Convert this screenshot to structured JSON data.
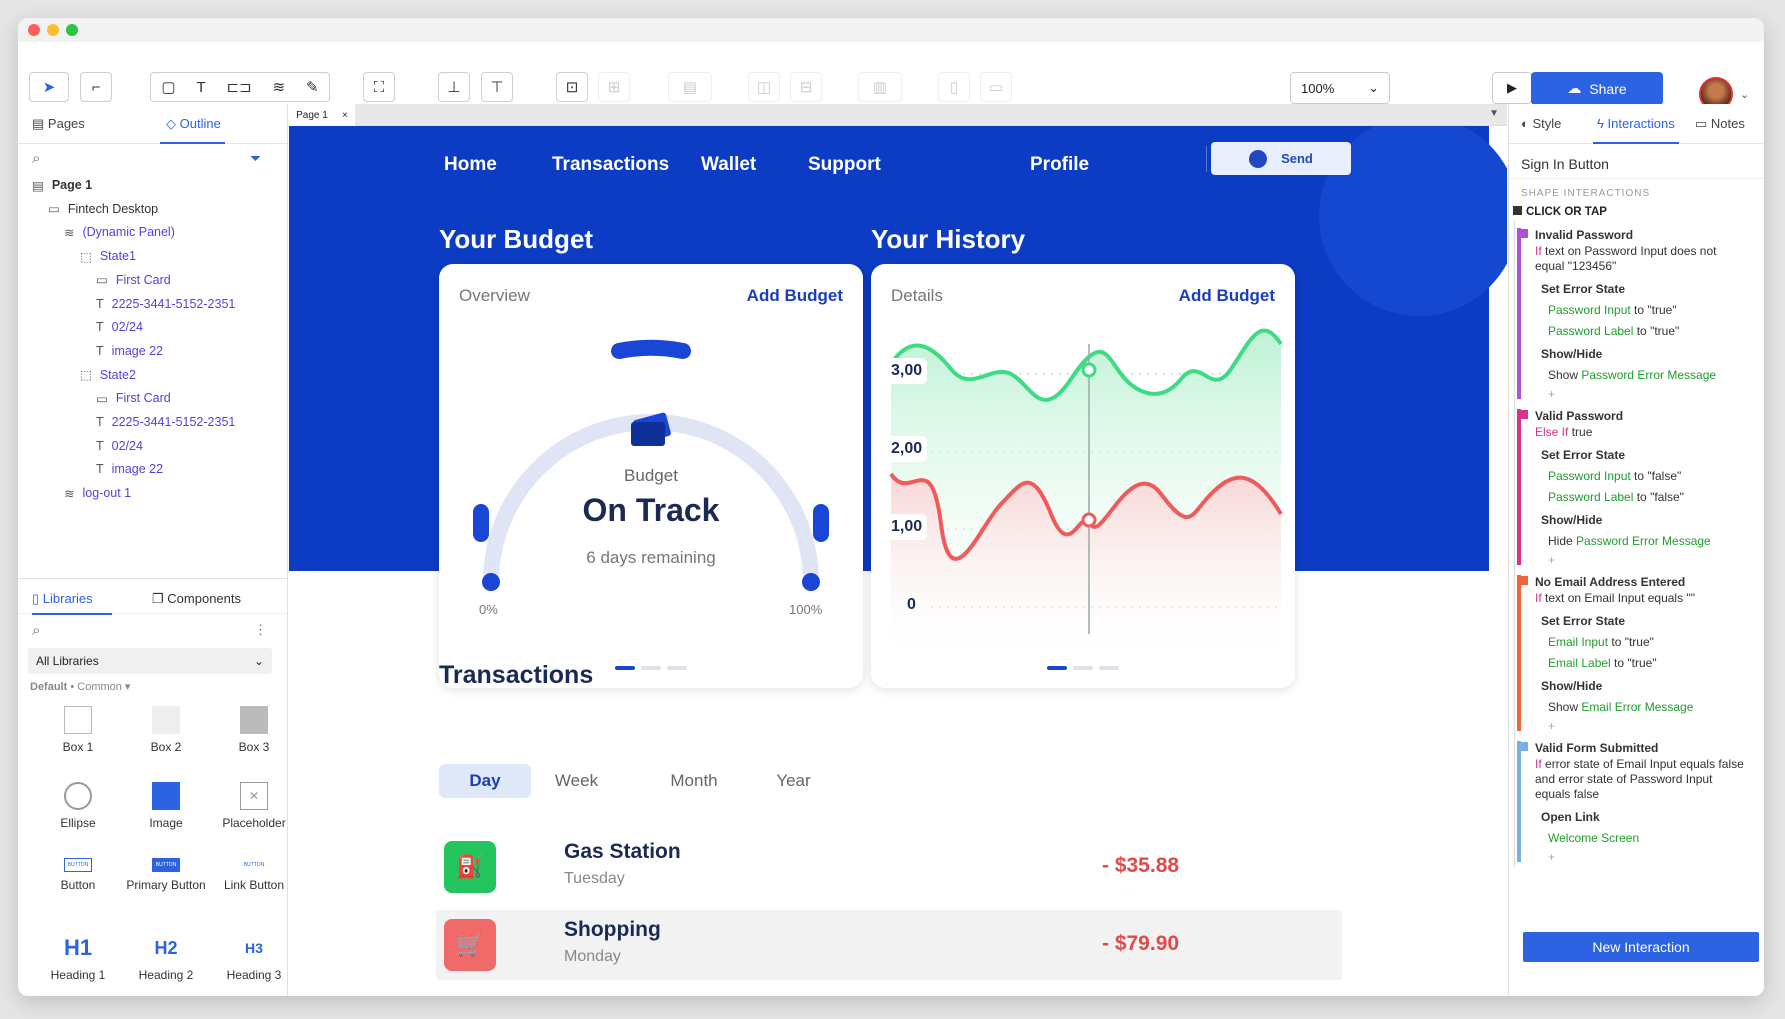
{
  "toolbar": {
    "zoom": "100%",
    "share": "Share"
  },
  "left_panel": {
    "tabs": {
      "pages": "Pages",
      "outline": "Outline"
    },
    "tree": [
      {
        "label": "Page 1",
        "indent": 0,
        "icon": "page-icon",
        "purple": false,
        "bold": true
      },
      {
        "label": "Fintech Desktop",
        "indent": 1,
        "icon": "folder-icon",
        "purple": false
      },
      {
        "label": "(Dynamic Panel)",
        "indent": 2,
        "icon": "layers-icon",
        "purple": true
      },
      {
        "label": "State1",
        "indent": 3,
        "icon": "state-icon",
        "purple": true
      },
      {
        "label": "First Card",
        "indent": 4,
        "icon": "rect-icon",
        "purple": true
      },
      {
        "label": "2225-3441-5152-2351",
        "indent": 4,
        "icon": "text-icon",
        "purple": true
      },
      {
        "label": "02/24",
        "indent": 4,
        "icon": "text-icon",
        "purple": true
      },
      {
        "label": "image 22",
        "indent": 4,
        "icon": "text-icon",
        "purple": true
      },
      {
        "label": "State2",
        "indent": 3,
        "icon": "state-icon",
        "purple": true
      },
      {
        "label": "First Card",
        "indent": 4,
        "icon": "rect-icon",
        "purple": true
      },
      {
        "label": "2225-3441-5152-2351",
        "indent": 4,
        "icon": "text-icon",
        "purple": true
      },
      {
        "label": "02/24",
        "indent": 4,
        "icon": "text-icon",
        "purple": true
      },
      {
        "label": "image 22",
        "indent": 4,
        "icon": "text-icon",
        "purple": true
      },
      {
        "label": "log-out 1",
        "indent": 2,
        "icon": "layers-icon",
        "purple": true
      }
    ],
    "lib_tabs": {
      "libraries": "Libraries",
      "components": "Components"
    },
    "lib_select": "All Libraries",
    "lib_default": "Default",
    "lib_common": "• Common ▾",
    "lib_items": [
      "Box 1",
      "Box 2",
      "Box 3",
      "Ellipse",
      "Image",
      "Placeholder",
      "Button",
      "Primary Button",
      "Link Button",
      "Heading 1",
      "Heading 2",
      "Heading 3"
    ],
    "lib_glyphs": [
      "H1",
      "H2",
      "H3"
    ],
    "button_glyph": "BUTTON"
  },
  "canvas": {
    "page_tab": "Page 1",
    "nav": [
      "Home",
      "Transactions",
      "Wallet",
      "Support"
    ],
    "profile": "Profile",
    "send": "Send",
    "budget_title": "Your Budget",
    "history_title": "Your History",
    "budget_card": {
      "overview": "Overview",
      "add": "Add Budget",
      "label": "Budget",
      "status": "On Track",
      "remaining": "6 days remaining",
      "min": "0%",
      "max": "100%"
    },
    "history_card": {
      "details": "Details",
      "add": "Add Budget",
      "yticks": [
        "3,00",
        "2,00",
        "1,00",
        "0"
      ]
    },
    "transactions_title": "Transactions",
    "periods": [
      "Day",
      "Week",
      "Month",
      "Year"
    ],
    "transactions": [
      {
        "name": "Gas Station",
        "day": "Tuesday",
        "amount": "- $35.88",
        "color": "#22c55e",
        "icon": "fuel-icon"
      },
      {
        "name": "Shopping",
        "day": "Monday",
        "amount": "- $79.90",
        "color": "#f06a6a",
        "icon": "cart-icon"
      }
    ]
  },
  "right_panel": {
    "tabs": {
      "style": "Style",
      "interactions": "Interactions",
      "notes": "Notes"
    },
    "selected": "Sign In Button",
    "section": "SHAPE INTERACTIONS",
    "event": "CLICK OR TAP",
    "cases": [
      {
        "name": "Invalid Password",
        "if_kw": "If",
        "cond": "text on Password Input does not equal \"123456\"",
        "color": "#b14fd6",
        "actions": [
          {
            "title": "Set Error State",
            "lines": [
              {
                "target": "Password Input",
                "rest": " to \"true\""
              },
              {
                "target": "Password Label",
                "rest": " to \"true\""
              }
            ]
          },
          {
            "title": "Show/Hide",
            "lines": [
              {
                "pre": "Show ",
                "target": "Password Error Message",
                "rest": ""
              }
            ]
          }
        ]
      },
      {
        "name": "Valid Password",
        "if_kw": "Else If",
        "cond": "true",
        "color": "#d6338e",
        "actions": [
          {
            "title": "Set Error State",
            "lines": [
              {
                "target": "Password Input",
                "rest": " to \"false\""
              },
              {
                "target": "Password Label",
                "rest": " to \"false\""
              }
            ]
          },
          {
            "title": "Show/Hide",
            "lines": [
              {
                "pre": "Hide ",
                "target": "Password Error Message",
                "rest": ""
              }
            ]
          }
        ]
      },
      {
        "name": "No Email Address Entered",
        "if_kw": "If",
        "cond": "text on Email Input equals \"\"",
        "color": "#f0643a",
        "actions": [
          {
            "title": "Set Error State",
            "lines": [
              {
                "target": "Email Input",
                "rest": " to \"true\""
              },
              {
                "target": "Email Label",
                "rest": " to \"true\""
              }
            ]
          },
          {
            "title": "Show/Hide",
            "lines": [
              {
                "pre": "Show ",
                "target": "Email Error Message",
                "rest": ""
              }
            ]
          }
        ]
      },
      {
        "name": "Valid Form Submitted",
        "if_kw": "If",
        "cond": "error state of Email Input equals false and error state of Password Input equals false",
        "color": "#7aaee8",
        "actions": [
          {
            "title": "Open Link",
            "lines": [
              {
                "target": "Welcome Screen",
                "rest": ""
              }
            ]
          }
        ]
      }
    ],
    "new_interaction": "New Interaction"
  }
}
